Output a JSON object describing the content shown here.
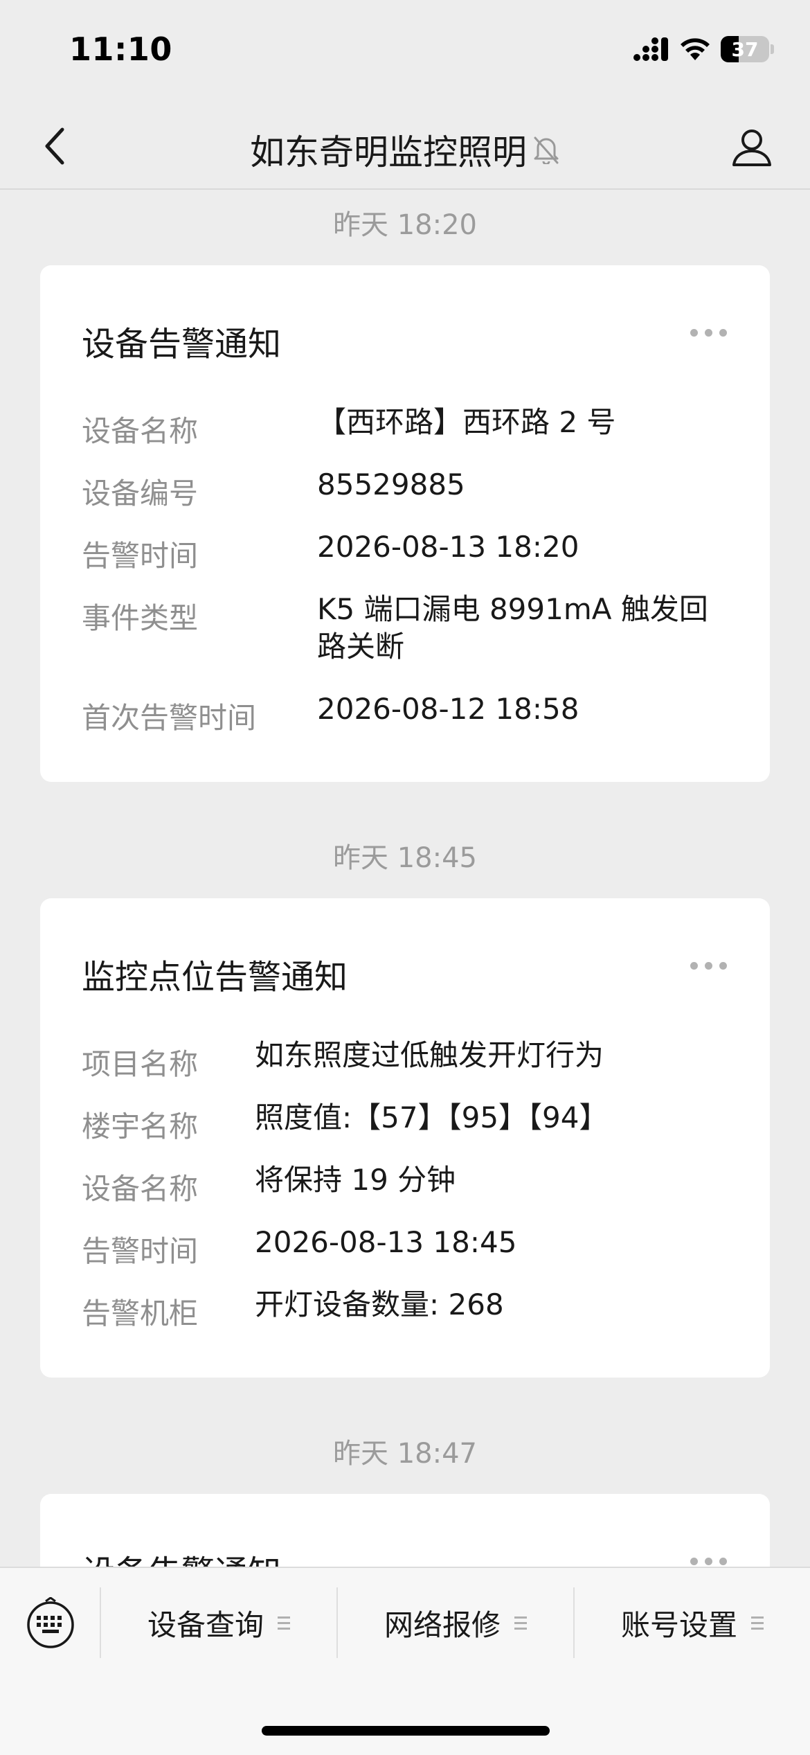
{
  "status_bar": {
    "time": "11:10",
    "battery_level": "37",
    "battery_fraction": 0.37
  },
  "nav": {
    "title": "如东奇明监控照明",
    "back_icon": "chevron-left-icon",
    "mute_icon": "bell-off-icon",
    "profile_icon": "person-icon"
  },
  "messages": [
    {
      "timestamp": "昨天 18:20",
      "title": "设备告警通知",
      "fields": [
        {
          "label": "设备名称",
          "value": "【西环路】西环路 2 号"
        },
        {
          "label": "设备编号",
          "value": "85529885"
        },
        {
          "label": "告警时间",
          "value": "2026-08-13 18:20"
        },
        {
          "label": "事件类型",
          "value": "K5 端口漏电 8991mA 触发回路关断"
        },
        {
          "label": "首次告警时间",
          "value": "2026-08-12 18:58"
        }
      ]
    },
    {
      "timestamp": "昨天 18:45",
      "title": "监控点位告警通知",
      "fields": [
        {
          "label": "项目名称",
          "value": "如东照度过低触发开灯行为"
        },
        {
          "label": "楼宇名称",
          "value": "照度值:【57】【95】【94】"
        },
        {
          "label": "设备名称",
          "value": "将保持 19 分钟"
        },
        {
          "label": "告警时间",
          "value": "2026-08-13 18:45"
        },
        {
          "label": "告警机柜",
          "value": "开灯设备数量: 268"
        }
      ]
    },
    {
      "timestamp": "昨天 18:47",
      "title": "设备告警通知"
    }
  ],
  "bottom_menu": {
    "keyboard_icon": "keyboard-icon",
    "items": [
      {
        "label": "设备查询"
      },
      {
        "label": "网络报修"
      },
      {
        "label": "账号设置"
      }
    ]
  },
  "colors": {
    "background": "#ededed",
    "card": "#ffffff",
    "label_gray": "#8f8f8f",
    "timestamp_gray": "#9b9b9b"
  }
}
